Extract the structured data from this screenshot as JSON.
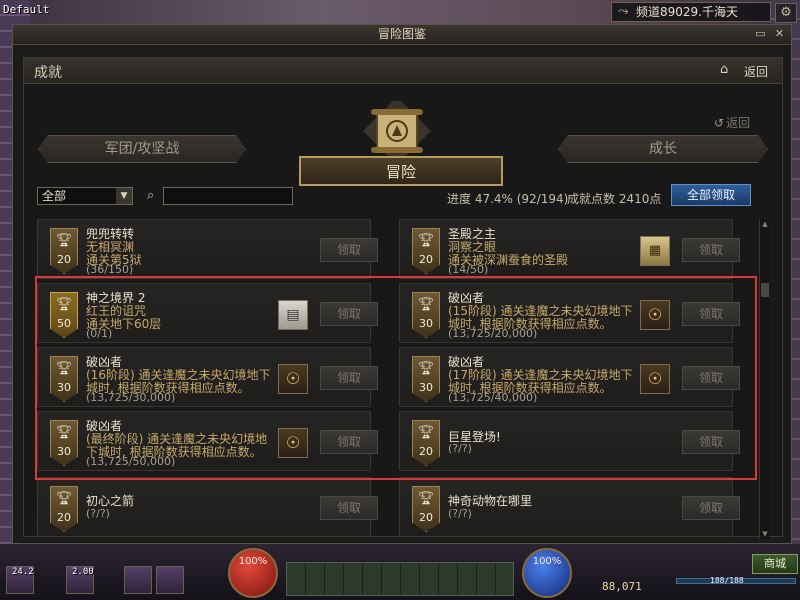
{
  "top": {
    "profile_name": "Default",
    "channel": "频道89029.千海天"
  },
  "window": {
    "title": "冒险图鉴"
  },
  "panel": {
    "title": "成就",
    "back_label": "返回",
    "inner_back_label": "返回"
  },
  "categories": {
    "left": "军团/攻坚战",
    "center": "冒险",
    "right": "成长"
  },
  "filter": {
    "selected": "全部",
    "search_value": ""
  },
  "stats": {
    "progress": "进度 47.4% (92/194)",
    "points": "成就点数 2410点",
    "claim_all": "全部领取"
  },
  "achievements": [
    {
      "title": "兜兜转转",
      "d1": "无相冥渊",
      "d2": "通关第5狱",
      "count": "(36/150)",
      "points": "20",
      "claim": "领取",
      "reward": ""
    },
    {
      "title": "圣殿之主",
      "d1": "洞察之眼",
      "d2": "通关被深渊蚕食的圣殿",
      "count": "(14/50)",
      "points": "20",
      "claim": "领取",
      "reward": "map"
    },
    {
      "title": "神之境界 2",
      "d1": "红王的诅咒",
      "d2": "通关地下60层",
      "count": "(0/1)",
      "points": "50",
      "claim": "领取",
      "reward": "scroll"
    },
    {
      "title": "破凶者",
      "d1": "(15阶段) 通关逢魔之未央幻境地下",
      "d2": "城时, 根据阶数获得相应点数。",
      "count": "(13,725/20,000)",
      "points": "30",
      "claim": "领取",
      "reward": "emblem"
    },
    {
      "title": "破凶者",
      "d1": "(16阶段) 通关逢魔之未央幻境地下",
      "d2": "城时, 根据阶数获得相应点数。",
      "count": "(13,725/30,000)",
      "points": "30",
      "claim": "领取",
      "reward": "emblem"
    },
    {
      "title": "破凶者",
      "d1": "(17阶段) 通关逢魔之未央幻境地下",
      "d2": "城时, 根据阶数获得相应点数。",
      "count": "(13,725/40,000)",
      "points": "30",
      "claim": "领取",
      "reward": "emblem"
    },
    {
      "title": "破凶者",
      "d1": "(最终阶段) 通关逢魔之未央幻境地",
      "d2": "下城时, 根据阶数获得相应点数。",
      "count": "(13,725/50,000)",
      "points": "30",
      "claim": "领取",
      "reward": "emblem"
    },
    {
      "title": "巨星登场!",
      "d1": "(?/?)",
      "d2": "",
      "count": "",
      "points": "20",
      "claim": "领取",
      "reward": ""
    },
    {
      "title": "初心之箭",
      "d1": "(?/?)",
      "d2": "",
      "count": "",
      "points": "20",
      "claim": "领取",
      "reward": ""
    },
    {
      "title": "神奇动物在哪里",
      "d1": "(?/?)",
      "d2": "",
      "count": "",
      "points": "20",
      "claim": "领取",
      "reward": ""
    }
  ],
  "hud": {
    "hp": "100%",
    "mp": "100%",
    "gold": "88,071",
    "shop": "商城",
    "fatigue": "188/188",
    "slots": [
      "24.2",
      "2.00"
    ]
  }
}
